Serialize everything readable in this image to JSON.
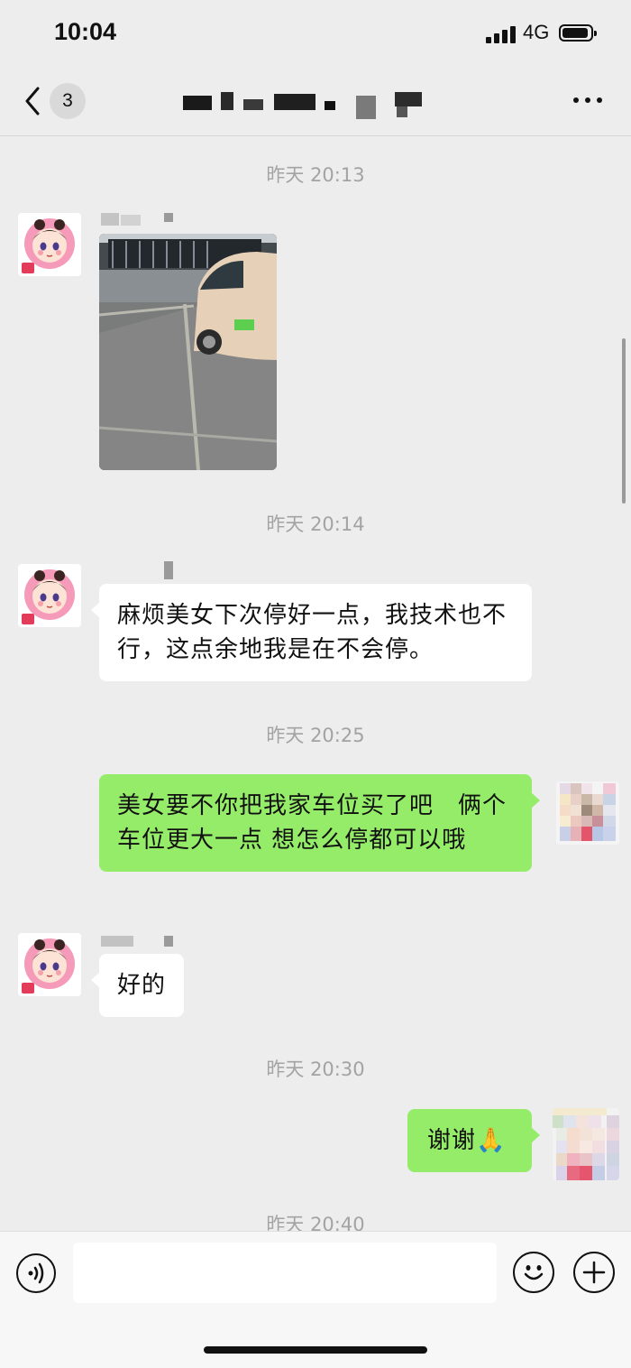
{
  "status_bar": {
    "time": "10:04",
    "network": "4G"
  },
  "nav": {
    "unread_count": "3"
  },
  "messages": {
    "ts1": "昨天 20:13",
    "ts2": "昨天 20:14",
    "msg2": "麻烦美女下次停好一点，我技术也不行，这点余地我是在不会停。",
    "ts3": "昨天 20:25",
    "msg3": "美女要不你把我家车位买了吧　俩个车位更大一点 想怎么停都可以哦",
    "msg4": "好的",
    "ts4": "昨天 20:30",
    "msg5": "谢谢🙏",
    "ts5": "昨天 20:40"
  },
  "icons": {
    "back": "chevron-left-icon",
    "more": "more-dots-icon",
    "voice": "voice-icon",
    "emoji": "emoji-icon",
    "plus": "plus-icon"
  },
  "colors": {
    "background": "#ededed",
    "bubble_sent": "#95ec69",
    "bubble_received": "#ffffff",
    "timestamp": "#a3a3a3"
  }
}
